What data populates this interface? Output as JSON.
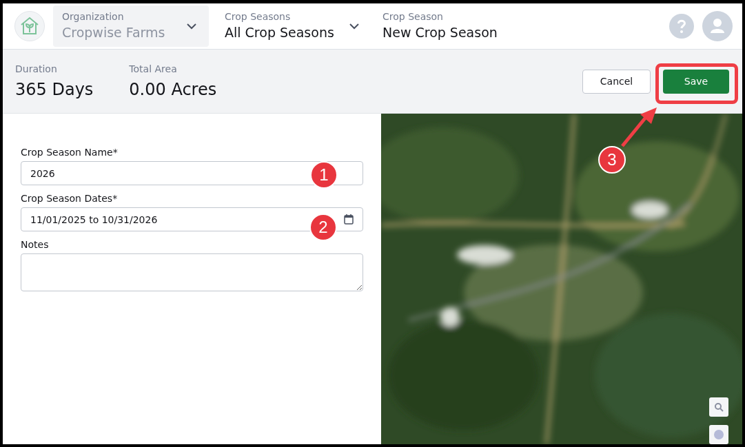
{
  "header": {
    "organization": {
      "label": "Organization",
      "value": "Cropwise Farms"
    },
    "crop_seasons": {
      "label": "Crop Seasons",
      "value": "All Crop Seasons"
    },
    "crop_season": {
      "label": "Crop Season",
      "value": "New Crop Season"
    }
  },
  "summary": [
    {
      "label": "Duration",
      "value": "365 Days"
    },
    {
      "label": "Total Area",
      "value": "0.00 Acres"
    }
  ],
  "buttons": [
    {
      "label": "Cancel",
      "kind": "secondary"
    },
    {
      "label": "Save",
      "kind": "primary"
    }
  ],
  "form": {
    "fields": [
      {
        "label": "Crop Season Name*",
        "value": "2026",
        "kind": "text"
      },
      {
        "label": "Crop Season Dates*",
        "value": "11/01/2025 to 10/31/2026",
        "kind": "date"
      },
      {
        "label": "Notes",
        "kind": "textarea"
      }
    ]
  },
  "annotations": [
    {
      "number": "1"
    },
    {
      "number": "2"
    },
    {
      "number": "3"
    }
  ]
}
